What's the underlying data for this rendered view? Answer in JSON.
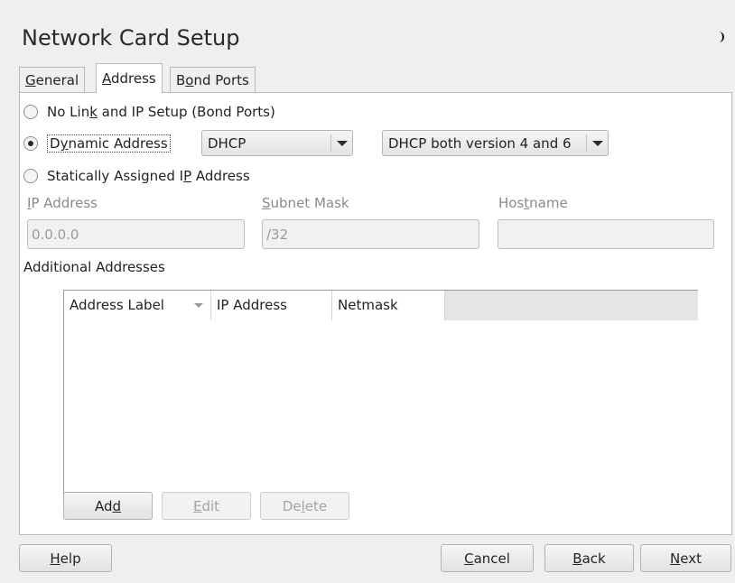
{
  "window": {
    "title": "Network Card Setup",
    "theme_icon": "moon-icon"
  },
  "tabs": [
    {
      "pre": "",
      "mn": "G",
      "post": "eneral"
    },
    {
      "pre": "",
      "mn": "A",
      "post": "ddress"
    },
    {
      "pre": "B",
      "mn": "o",
      "post": "nd Ports"
    }
  ],
  "radios": {
    "no_link": {
      "pre": "No Lin",
      "mn": "k",
      "post": " and IP Setup (Bond Ports)"
    },
    "dynamic": {
      "pre": "D",
      "mn": "y",
      "post": "namic Address"
    },
    "static": {
      "pre": "Statically Assigned I",
      "mn": "P",
      "post": " Address"
    }
  },
  "dhcp_combo": {
    "value": "DHCP"
  },
  "version_combo": {
    "value": "DHCP both version 4 and 6"
  },
  "fields": {
    "ip": {
      "mn": "I",
      "post": "P Address",
      "value": "0.0.0.0"
    },
    "subnet": {
      "mn": "S",
      "post": "ubnet Mask",
      "value": "/32"
    },
    "host": {
      "pre": "Hos",
      "mn": "t",
      "post": "name",
      "value": ""
    }
  },
  "additional": {
    "title": "Additional Addresses"
  },
  "table": {
    "columns": [
      "Address Label",
      "IP Address",
      "Netmask"
    ],
    "rows": []
  },
  "table_buttons": {
    "add": {
      "pre": "Ad",
      "mn": "d",
      "post": ""
    },
    "edit": {
      "pre": "",
      "mn": "E",
      "post": "dit"
    },
    "delete": {
      "pre": "De",
      "mn": "l",
      "post": "ete"
    }
  },
  "footer": {
    "help": {
      "pre": "",
      "mn": "H",
      "post": "elp"
    },
    "cancel": {
      "pre": "",
      "mn": "C",
      "post": "ancel"
    },
    "back": {
      "pre": "",
      "mn": "B",
      "post": "ack"
    },
    "next": {
      "pre": "",
      "mn": "N",
      "post": "ext"
    }
  },
  "colors": {
    "panel": "#ffffff",
    "background": "#efefef",
    "border": "#b9b9b9"
  }
}
